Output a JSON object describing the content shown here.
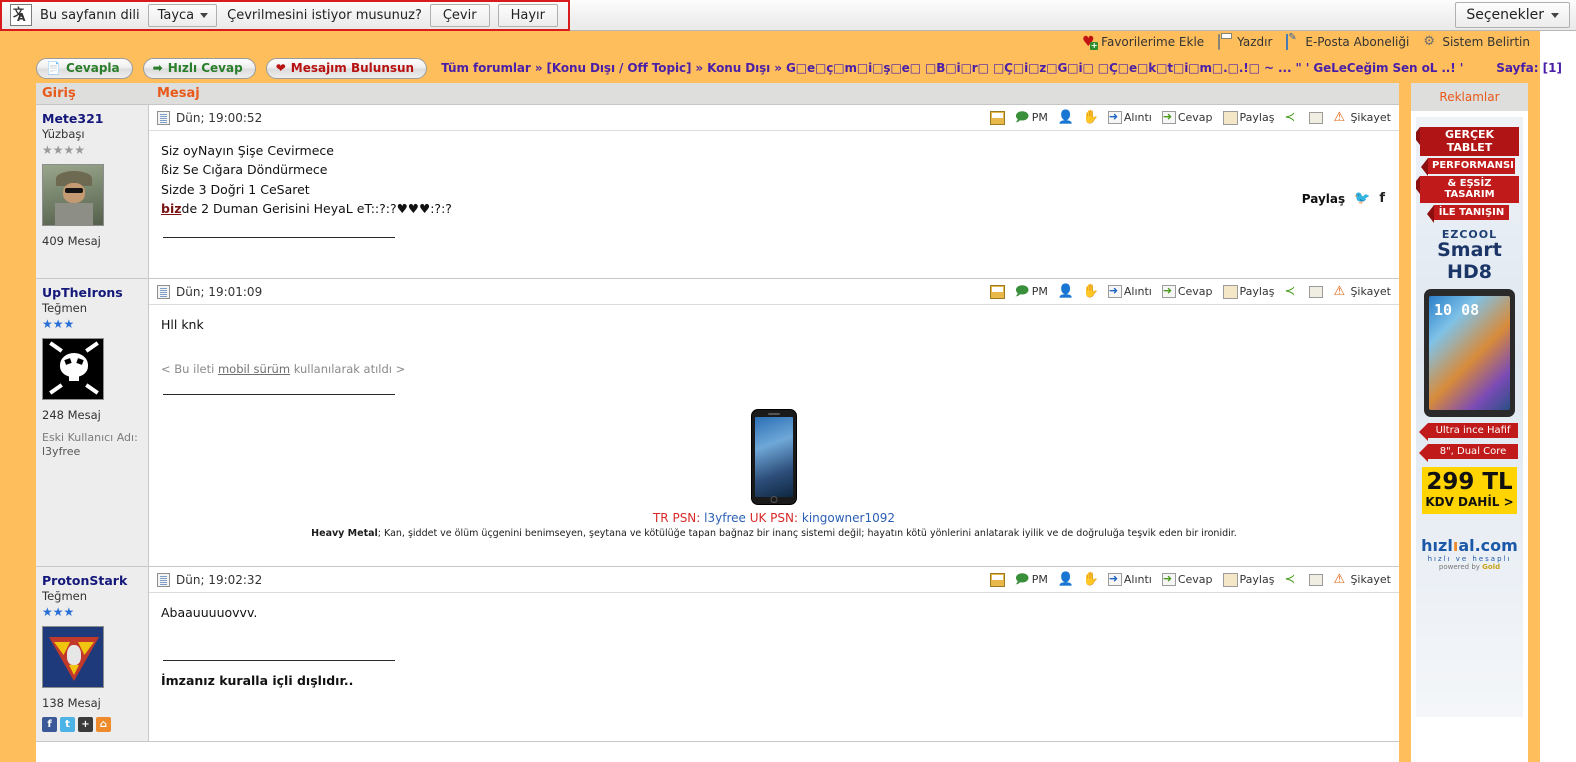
{
  "translate_bar": {
    "icon": "translate-icon",
    "prompt": "Bu sayfanın dili",
    "language": "Tayca",
    "question": "Çevrilmesini istiyor musunuz?",
    "translate_label": "Çevir",
    "no_label": "Hayır",
    "options_label": "Seçenekler"
  },
  "topbar": {
    "links": [
      {
        "icon": "heart-plus-icon",
        "label": "Favorilerime Ekle"
      },
      {
        "icon": "printer-icon",
        "label": "Yazdır"
      },
      {
        "icon": "envelope-edit-icon",
        "label": "E-Posta Aboneliği"
      },
      {
        "icon": "gear-icon",
        "label": "Sistem Belirtin"
      }
    ]
  },
  "actionbar": {
    "buttons": [
      {
        "icon": "page-icon",
        "label": "Cevapla"
      },
      {
        "icon": "arrow-right-icon",
        "label": "Hızlı Cevap"
      },
      {
        "icon": "heart-plus-icon",
        "label": "Mesajım Bulunsun"
      }
    ],
    "breadcrumb": "Tüm forumlar » [Konu Dışı / Off Topic] » Konu Dışı » G□e□ç□m□i□ş□e□ □B□i□r□ □Ç□i□z□G□i□ □Ç□e□k□t□i□m□.□.!□ ~ ... \" ' GeLeCeğim Sen oL ..! '",
    "page_label": "Sayfa: [1]"
  },
  "forum": {
    "col_login": "Giriş",
    "col_message": "Mesaj",
    "tools": [
      {
        "icon": "mail-icon",
        "label": ""
      },
      {
        "icon": "pm-icon",
        "label": "PM"
      },
      {
        "icon": "add-user-icon",
        "label": ""
      },
      {
        "icon": "hand-icon",
        "label": ""
      },
      {
        "icon": "quote-icon",
        "label": "Alıntı"
      },
      {
        "icon": "reply-icon",
        "label": "Cevap"
      },
      {
        "icon": "share-hand-icon",
        "label": "Paylaş"
      },
      {
        "icon": "share-node-icon",
        "label": ""
      },
      {
        "icon": "link-icon",
        "label": ""
      },
      {
        "icon": "warning-icon",
        "label": "Şikayet"
      }
    ],
    "posts": [
      {
        "username": "Mete321",
        "rank": "Yüzbaşı",
        "stars": "★★★★",
        "star_color": "gray",
        "messages": "409 Mesaj",
        "date": "Dün; 19:00:52",
        "lines": [
          "Siz oyNayın Şişe Cevirmece",
          "ßiz Se Cığara Döndürmece",
          "Sizde 3 Doğri 1 CeSaret"
        ],
        "last_line_prefix": "biz",
        "last_line_rest": "de 2 Duman Gerisini HeyaL eT::?:?♥♥♥:?:?",
        "share_label": "Paylaş"
      },
      {
        "username": "UpTheIrons",
        "rank": "Teğmen",
        "stars": "★★★",
        "star_color": "blue",
        "messages": "248 Mesaj",
        "old_name_label": "Eski Kullanıcı Adı:",
        "old_name_value": "l3yfree",
        "date": "Dün; 19:01:09",
        "text": "Hll knk",
        "mobile_note_pre": "< Bu ileti ",
        "mobile_note_link": "mobil sürüm",
        "mobile_note_post": " kullanılarak atıldı >",
        "sig_psn_tr_label": "TR PSN:",
        "sig_psn_tr_value": "l3yfree",
        "sig_psn_uk_label": "UK PSN:",
        "sig_psn_uk_value": "kingowner1092",
        "sig_meta_bold": "Heavy Metal",
        "sig_meta_text": "; Kan, şiddet ve ölüm üçgenini benimseyen, şeytana ve kötülüğe tapan bağnaz bir inanç sistemi değil; hayatın kötü yönlerini anlatarak iyilik ve de doğruluğa teşvik eden bir ironidir."
      },
      {
        "username": "ProtonStark",
        "rank": "Teğmen",
        "stars": "★★★",
        "star_color": "blue",
        "messages": "138 Mesaj",
        "date": "Dün; 19:02:32",
        "text": "Abaauuuuovvv.",
        "sig_text": "İmzanız kuralla içli dışlıdır..",
        "socials": [
          {
            "icon": "facebook-icon",
            "glyph": "f"
          },
          {
            "icon": "twitter-icon",
            "glyph": "t"
          },
          {
            "icon": "addthis-icon",
            "glyph": "+"
          },
          {
            "icon": "home-icon",
            "glyph": "⌂"
          }
        ]
      }
    ]
  },
  "ads": {
    "header": "Reklamlar",
    "ribbon1": "GERÇEK TABLET",
    "ribbon2": "PERFORMANSI",
    "ribbon3": "& EŞSİZ TASARIM",
    "ribbon4": "İLE TANIŞIN",
    "brand": "EZCOOL",
    "model": "Smart HD8",
    "clock": "10 08",
    "tag1": "Ultra ince Hafif",
    "tag2": "8\", Dual Core",
    "price": "299 TL",
    "price_sub": "KDV DAHİL >",
    "site_name": "hızlıal.com",
    "site_tag": "hızlı ve hesaplı",
    "site_gold": "powered by Gold"
  },
  "colors": {
    "orange_frame": "#ffbe5c",
    "header_orange": "#e8591a",
    "breadcrumb_purple": "#4a1fa8",
    "username_blue": "#14187a",
    "red_border": "#d81c1c"
  }
}
